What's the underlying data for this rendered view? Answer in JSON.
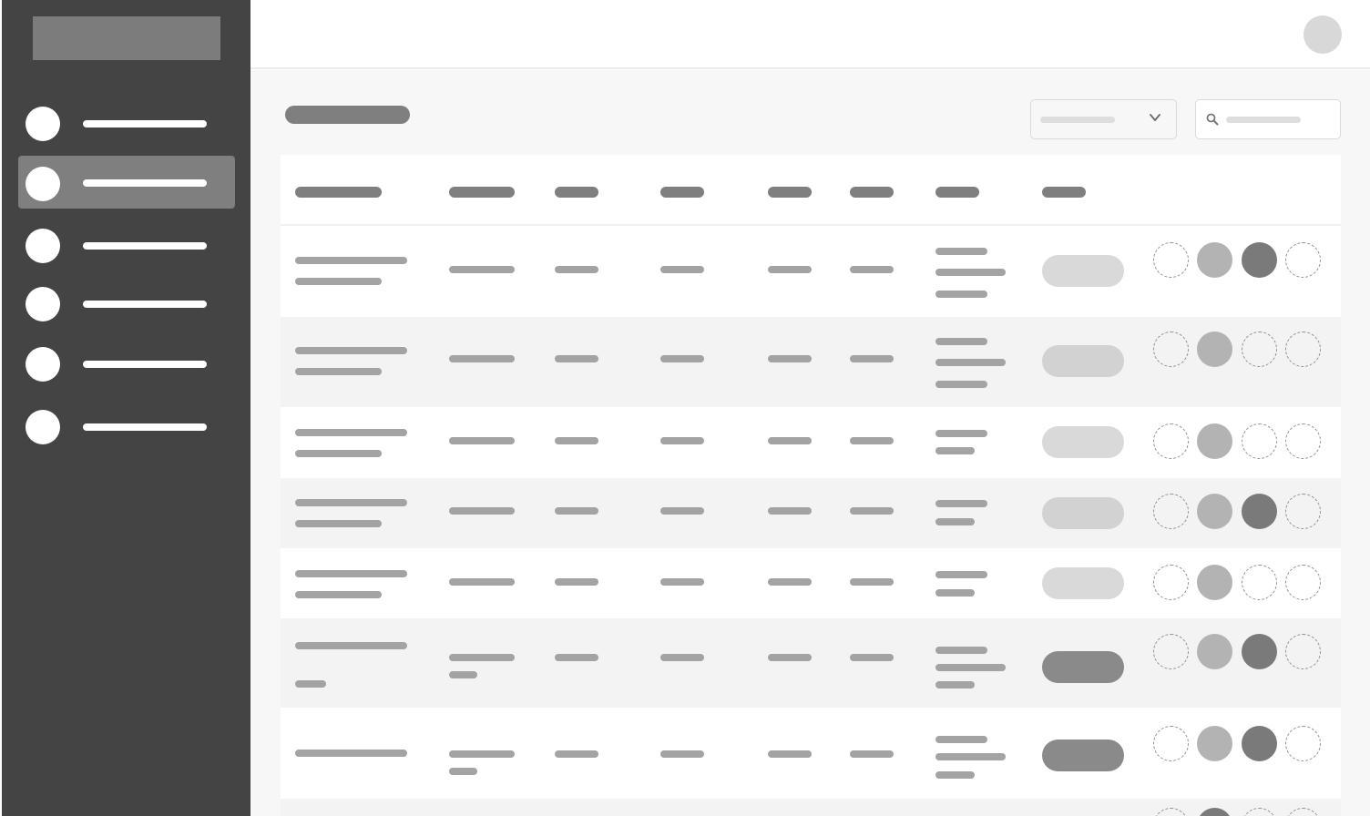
{
  "colors": {
    "sidebar_bg": "#444444",
    "active_nav_bg": "#7f7f7f",
    "content_bg": "#f7f7f7",
    "placeholder_dark": "#7f7f7f",
    "placeholder_mid": "#a3a3a3",
    "pill_light": "#d9d9d9",
    "pill_dark": "#8a8a8a",
    "circle_light": "#b3b3b3",
    "circle_dark": "#7a7a7a"
  },
  "sidebar": {
    "nav_icon": "circle-icon",
    "items": [
      {
        "id": "nav-1",
        "active": false
      },
      {
        "id": "nav-2",
        "active": true
      },
      {
        "id": "nav-3",
        "active": false
      },
      {
        "id": "nav-4",
        "active": false
      },
      {
        "id": "nav-5",
        "active": false
      },
      {
        "id": "nav-6",
        "active": false
      }
    ]
  },
  "toolbar": {
    "filter_icon": "chevron-down-icon",
    "search_icon": "search-icon"
  },
  "table": {
    "columns": 9,
    "rows": [
      {
        "pill": "light",
        "indicators": [
          "empty",
          "light",
          "dark",
          "empty"
        ]
      },
      {
        "pill": "light",
        "indicators": [
          "empty",
          "light",
          "empty",
          "empty"
        ]
      },
      {
        "pill": "light",
        "indicators": [
          "empty",
          "light",
          "empty",
          "empty"
        ]
      },
      {
        "pill": "light",
        "indicators": [
          "empty",
          "light",
          "dark",
          "empty"
        ]
      },
      {
        "pill": "light",
        "indicators": [
          "empty",
          "light",
          "empty",
          "empty"
        ]
      },
      {
        "pill": "dark",
        "indicators": [
          "empty",
          "light",
          "dark",
          "empty"
        ]
      },
      {
        "pill": "dark",
        "indicators": [
          "empty",
          "light",
          "dark",
          "empty"
        ]
      }
    ]
  }
}
